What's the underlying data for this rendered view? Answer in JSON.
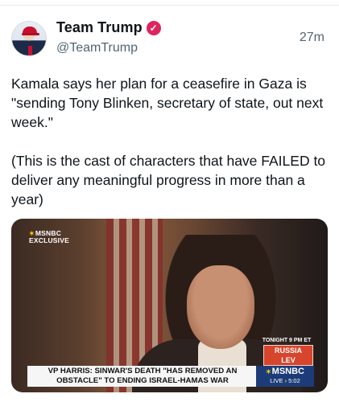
{
  "account": {
    "display_name": "Team Trump",
    "handle": "@TeamTrump",
    "verified_badge_icon": "verified-badge-icon",
    "badge_color": "#e0245e"
  },
  "tweet": {
    "timestamp": "27m",
    "text": "Kamala says her plan for a ceasefire in Gaza is \"sending Tony Blinken, secretary of state, out next week.\"\n\n(This is the cast of characters that have FAILED to deliver any meaningful progress in more than a year)"
  },
  "media": {
    "network_tag": "MSNBC",
    "exclusive_tag": "EXCLUSIVE",
    "promo_top": "TONIGHT 9 PM ET",
    "promo_title_1": "RUSSIA",
    "promo_title_2": "LEV",
    "lower_third_text": "VP HARRIS: SINWAR'S DEATH \"HAS REMOVED AN OBSTACLE\" TO ENDING ISRAEL-HAMAS WAR",
    "brand_logo": "MSNBC",
    "live_label": "LIVE",
    "live_time": "5:02"
  }
}
